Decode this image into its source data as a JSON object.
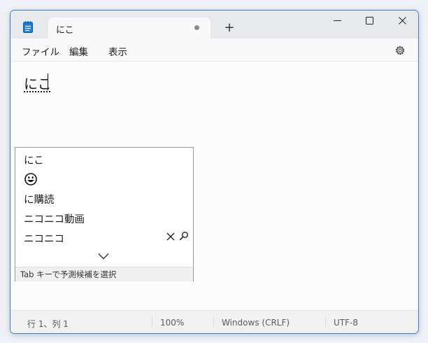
{
  "window": {
    "tab_title": "にこ",
    "new_tab_label": "+"
  },
  "menu": {
    "items": [
      "ファイル",
      "編集",
      "表示"
    ]
  },
  "editor": {
    "text": "にこ"
  },
  "suggestions": {
    "items": [
      "にこ",
      "に購読",
      "ニコニコ動画",
      "ニコニコ"
    ],
    "emoji_icon": "grinning-face-icon",
    "hint": "Tab キーで予測候補を選択"
  },
  "status": {
    "position": "行 1、列 1",
    "zoom": "100%",
    "line_ending": "Windows (CRLF)",
    "encoding": "UTF-8"
  },
  "colors": {
    "window_border": "#3a7bd5",
    "titlebar": "#e7e9ec"
  }
}
